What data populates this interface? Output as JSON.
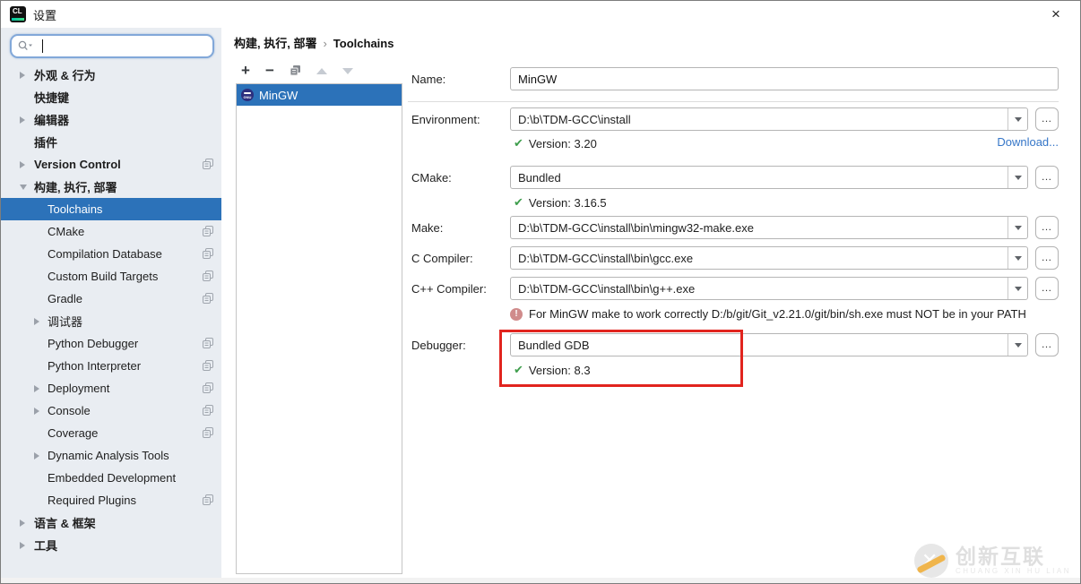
{
  "window": {
    "title": "设置",
    "close_glyph": "×"
  },
  "sidebar": {
    "search": {
      "value": "",
      "placeholder": ""
    },
    "items": [
      {
        "label": "外观 & 行为",
        "level": 0,
        "arrow": "collapsed",
        "bold": true,
        "selected": false,
        "copy_icon": false
      },
      {
        "label": "快捷键",
        "level": 0,
        "arrow": "none",
        "bold": true,
        "selected": false,
        "copy_icon": false
      },
      {
        "label": "编辑器",
        "level": 0,
        "arrow": "collapsed",
        "bold": true,
        "selected": false,
        "copy_icon": false
      },
      {
        "label": "插件",
        "level": 0,
        "arrow": "none",
        "bold": true,
        "selected": false,
        "copy_icon": false
      },
      {
        "label": "Version Control",
        "level": 0,
        "arrow": "collapsed",
        "bold": true,
        "selected": false,
        "copy_icon": true
      },
      {
        "label": "构建, 执行, 部署",
        "level": 0,
        "arrow": "expanded",
        "bold": true,
        "selected": false,
        "copy_icon": false
      },
      {
        "label": "Toolchains",
        "level": 1,
        "arrow": "none",
        "bold": false,
        "selected": true,
        "copy_icon": false
      },
      {
        "label": "CMake",
        "level": 1,
        "arrow": "none",
        "bold": false,
        "selected": false,
        "copy_icon": true
      },
      {
        "label": "Compilation Database",
        "level": 1,
        "arrow": "none",
        "bold": false,
        "selected": false,
        "copy_icon": true
      },
      {
        "label": "Custom Build Targets",
        "level": 1,
        "arrow": "none",
        "bold": false,
        "selected": false,
        "copy_icon": true
      },
      {
        "label": "Gradle",
        "level": 1,
        "arrow": "none",
        "bold": false,
        "selected": false,
        "copy_icon": true
      },
      {
        "label": "调试器",
        "level": 1,
        "arrow": "collapsed",
        "bold": false,
        "selected": false,
        "copy_icon": false
      },
      {
        "label": "Python Debugger",
        "level": 1,
        "arrow": "none",
        "bold": false,
        "selected": false,
        "copy_icon": true
      },
      {
        "label": "Python Interpreter",
        "level": 1,
        "arrow": "none",
        "bold": false,
        "selected": false,
        "copy_icon": true
      },
      {
        "label": "Deployment",
        "level": 1,
        "arrow": "collapsed",
        "bold": false,
        "selected": false,
        "copy_icon": true
      },
      {
        "label": "Console",
        "level": 1,
        "arrow": "collapsed",
        "bold": false,
        "selected": false,
        "copy_icon": true
      },
      {
        "label": "Coverage",
        "level": 1,
        "arrow": "none",
        "bold": false,
        "selected": false,
        "copy_icon": true
      },
      {
        "label": "Dynamic Analysis Tools",
        "level": 1,
        "arrow": "collapsed",
        "bold": false,
        "selected": false,
        "copy_icon": false
      },
      {
        "label": "Embedded Development",
        "level": 1,
        "arrow": "none",
        "bold": false,
        "selected": false,
        "copy_icon": false
      },
      {
        "label": "Required Plugins",
        "level": 1,
        "arrow": "none",
        "bold": false,
        "selected": false,
        "copy_icon": true
      },
      {
        "label": "语言 & 框架",
        "level": 0,
        "arrow": "collapsed",
        "bold": true,
        "selected": false,
        "copy_icon": false
      },
      {
        "label": "工具",
        "level": 0,
        "arrow": "collapsed",
        "bold": true,
        "selected": false,
        "copy_icon": false
      }
    ]
  },
  "breadcrumb": {
    "path": "构建, 执行, 部署",
    "separator": "›",
    "current": "Toolchains"
  },
  "toolchain_list": {
    "toolbar": {
      "add": "+",
      "remove": "−"
    },
    "items": [
      {
        "label": "MinGW",
        "selected": true
      }
    ]
  },
  "form": {
    "name": {
      "label": "Name:",
      "value": "MinGW"
    },
    "environment": {
      "label": "Environment:",
      "value": "D:\\b\\TDM-GCC\\install",
      "version": "Version: 3.20",
      "download_label": "Download..."
    },
    "cmake": {
      "label": "CMake:",
      "value": "Bundled",
      "version": "Version: 3.16.5"
    },
    "make": {
      "label": "Make:",
      "value": "D:\\b\\TDM-GCC\\install\\bin\\mingw32-make.exe"
    },
    "c_compiler": {
      "label": "C Compiler:",
      "value": "D:\\b\\TDM-GCC\\install\\bin\\gcc.exe"
    },
    "cpp_compiler": {
      "label": "C++ Compiler:",
      "value": "D:\\b\\TDM-GCC\\install\\bin\\g++.exe"
    },
    "warning": "For MinGW make to work correctly D:/b/git/Git_v2.21.0/git/bin/sh.exe must NOT be in your PATH",
    "debugger": {
      "label": "Debugger:",
      "value": "Bundled GDB",
      "version": "Version: 8.3"
    }
  },
  "watermark": {
    "title": "创新互联",
    "subtitle": "CHUANG XIN HU LIAN"
  }
}
